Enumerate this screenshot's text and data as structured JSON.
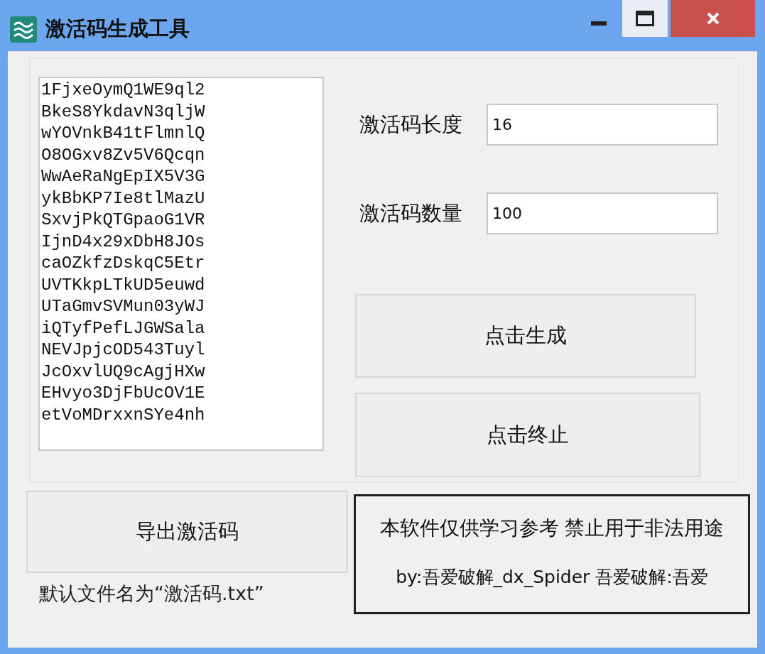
{
  "window": {
    "title": "激活码生成工具"
  },
  "output": {
    "lines": [
      "1FjxeOymQ1WE9ql2",
      "BkeS8YkdavN3qljW",
      "wYOVnkB41tFlmnlQ",
      "O8OGxv8Zv5V6Qcqn",
      "WwAeRaNgEpIX5V3G",
      "ykBbKP7Ie8tlMazU",
      "SxvjPkQTGpaoG1VR",
      "IjnD4x29xDbH8JOs",
      "caOZkfzDskqC5Etr",
      "UVTKkpLTkUD5euwd",
      "UTaGmvSVMun03yWJ",
      "iQTyfPefLJGWSala",
      "NEVJpjcOD543Tuyl",
      "JcOxvlUQ9cAgjHXw",
      "EHvyo3DjFbUcOV1E",
      "etVoMDrxxnSYe4nh"
    ]
  },
  "fields": [
    {
      "label": "激活码长度",
      "value": "16"
    },
    {
      "label": "激活码数量",
      "value": "100"
    }
  ],
  "buttons": [
    {
      "label": "点击生成"
    },
    {
      "label": "点击终止"
    }
  ],
  "export": {
    "button": "导出激活码",
    "note": "默认文件名为“激活码.txt”"
  },
  "notice": {
    "lines": [
      "本软件仅供学习参考 禁止用于非法用途",
      "by:吾爱破解_dx_Spider 吾爱破解:吾爱"
    ]
  }
}
